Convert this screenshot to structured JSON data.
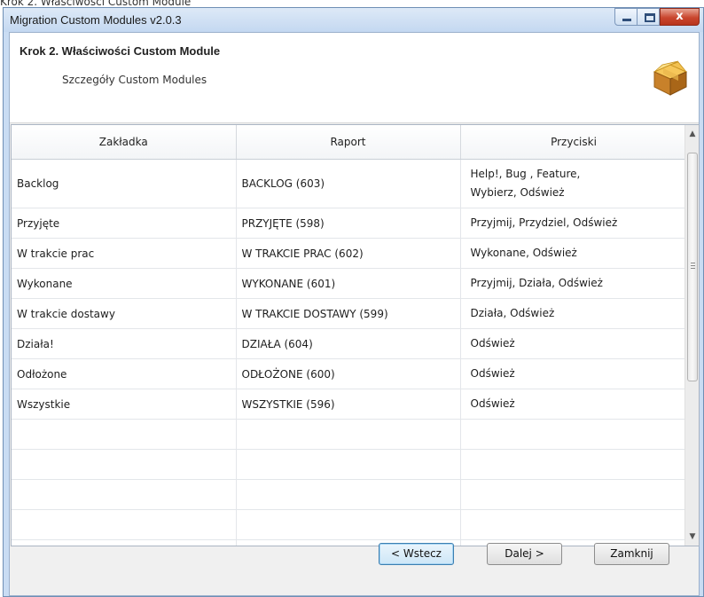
{
  "caption": "Krok 2. Właściwości Custom Module",
  "window": {
    "title": "Migration Custom Modules v2.0.3",
    "close_glyph": "x"
  },
  "header": {
    "title": "Krok 2. Właściwości Custom Module",
    "subtitle": "Szczegóły Custom Modules",
    "icon": "package-box-icon"
  },
  "table": {
    "columns": [
      "Zakładka",
      "Raport",
      "Przyciski"
    ],
    "rows": [
      {
        "tab": "Backlog",
        "report": "BACKLOG (603)",
        "buttons_line1": "Help!, Bug , Feature,",
        "buttons_line2": "Wybierz, Odśwież"
      },
      {
        "tab": "Przyjęte",
        "report": "PRZYJĘTE (598)",
        "buttons": "Przyjmij, Przydziel, Odśwież"
      },
      {
        "tab": "W trakcie prac",
        "report": "W TRAKCIE PRAC (602)",
        "buttons": "Wykonane, Odśwież"
      },
      {
        "tab": "Wykonane",
        "report": "WYKONANE (601)",
        "buttons": "Przyjmij, Działa, Odśwież"
      },
      {
        "tab": "W trakcie dostawy",
        "report": "W TRAKCIE DOSTAWY (599)",
        "buttons": "Działa, Odśwież"
      },
      {
        "tab": "Działa!",
        "report": "DZIAŁA (604)",
        "buttons": "Odśwież"
      },
      {
        "tab": "Odłożone",
        "report": "ODŁOŻONE (600)",
        "buttons": "Odśwież"
      },
      {
        "tab": "Wszystkie",
        "report": "WSZYSTKIE (596)",
        "buttons": "Odśwież"
      }
    ]
  },
  "footer": {
    "back_label": "< Wstecz",
    "next_label": "Dalej >",
    "close_label": "Zamknij"
  }
}
